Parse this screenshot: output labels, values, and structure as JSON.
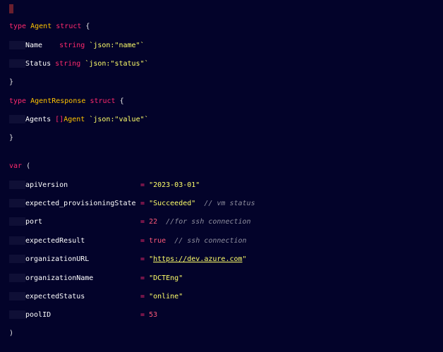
{
  "code": {
    "agent_struct": {
      "kw_type": "type",
      "name": "Agent",
      "kw_struct": "struct",
      "open": "{",
      "close": "}",
      "fields": [
        {
          "name": "Name  ",
          "type": "string",
          "tag": "`json:\"name\"`"
        },
        {
          "name": "Status",
          "type": "string",
          "tag": "`json:\"status\"`"
        }
      ]
    },
    "response_struct": {
      "kw_type": "type",
      "name": "AgentResponse",
      "kw_struct": "struct",
      "open": "{",
      "close": "}",
      "field_name": "Agents",
      "field_type_prefix": "[]",
      "field_type": "Agent",
      "field_tag": "`json:\"value\"`"
    },
    "var_block": {
      "kw_var": "var",
      "open": "(",
      "close": ")",
      "vars": [
        {
          "name": "apiVersion",
          "value": "\"2023-03-01\"",
          "kind": "str",
          "comment": ""
        },
        {
          "name": "expected_provisioningState",
          "value": "\"Succeeded\"",
          "kind": "str",
          "comment": "// vm status"
        },
        {
          "name": "port",
          "value": "22",
          "kind": "num",
          "comment": "//for ssh connection"
        },
        {
          "name": "expectedResult",
          "value": "true",
          "kind": "num",
          "comment": "// ssh connection"
        },
        {
          "name": "organizationURL",
          "value_prefix": "\"",
          "url": "https://dev.azure.com",
          "value_suffix": "\"",
          "kind": "url",
          "comment": ""
        },
        {
          "name": "organizationName",
          "value": "\"DCTEng\"",
          "kind": "str",
          "comment": ""
        },
        {
          "name": "expectedStatus",
          "value": "\"online\"",
          "kind": "str",
          "comment": ""
        },
        {
          "name": "poolID",
          "value": "53",
          "kind": "num",
          "comment": ""
        }
      ],
      "assign": "="
    }
  },
  "colors": {
    "background": "#03032a",
    "keyword": "#ff2a6d",
    "type": "#ffc400",
    "string": "#ffff6a",
    "number": "#ff5a7a",
    "comment": "#8e8e9e",
    "cursor": "#6a1f2e"
  }
}
